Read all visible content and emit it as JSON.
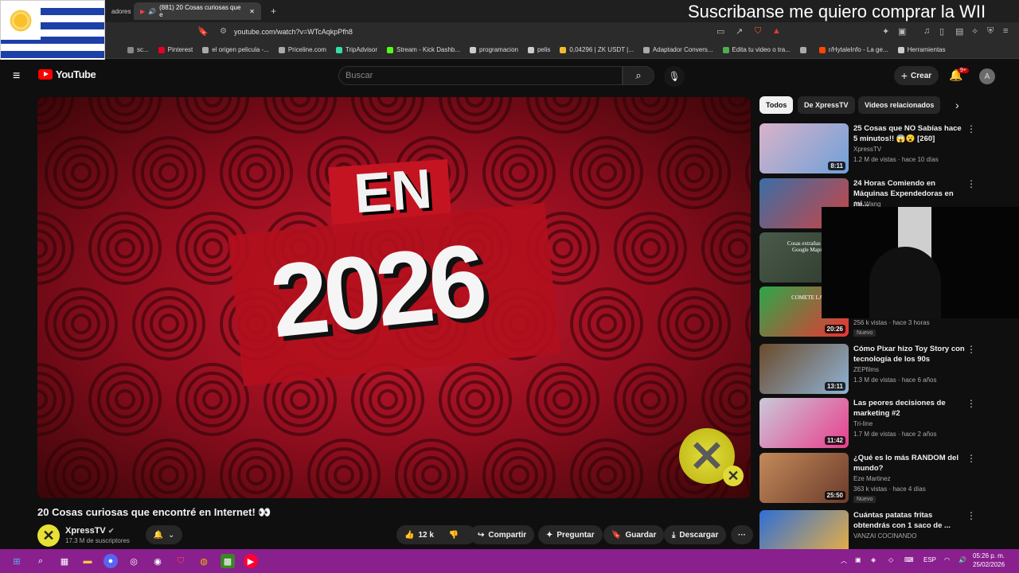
{
  "browser": {
    "tabs": [
      {
        "label": "adores",
        "active": false
      },
      {
        "label": "(881) 20 Cosas curiosas que e",
        "active": true
      }
    ],
    "new_tab": "+",
    "url": "youtube.com/watch?v=WTcAqkpPfh8",
    "bookmarks": [
      {
        "label": "sc...",
        "color": "#888888"
      },
      {
        "label": "Pinterest",
        "color": "#e60023"
      },
      {
        "label": "el origen pelicula -...",
        "color": "#aaaaaa"
      },
      {
        "label": "Priceline.com",
        "color": "#aaaaaa"
      },
      {
        "label": "TripAdvisor",
        "color": "#34e0a1"
      },
      {
        "label": "Stream - Kick Dashb...",
        "color": "#53fc18"
      },
      {
        "label": "programacion",
        "color": "#cccccc"
      },
      {
        "label": "pelis",
        "color": "#cccccc"
      },
      {
        "label": "0,04296 | ZK USDT |...",
        "color": "#f3ba2f"
      },
      {
        "label": "Adaptador Convers...",
        "color": "#aaaaaa"
      },
      {
        "label": "Edita tu video o tra...",
        "color": "#4caf50"
      },
      {
        "label": "",
        "color": "#aaaaaa"
      },
      {
        "label": "r/HytaleInfo - La ge...",
        "color": "#ff4500"
      },
      {
        "label": "Herramientas",
        "color": "#cccccc"
      }
    ]
  },
  "overlay": {
    "scroll_text": "Suscribanse me quiero comprar la WII"
  },
  "youtube": {
    "logo": "YouTube",
    "search_placeholder": "Buscar",
    "create": "Crear",
    "notif_badge": "9+",
    "avatar_letter": "A"
  },
  "video": {
    "en": "EN",
    "year": "2026",
    "title": "20 Cosas curiosas que encontré en Internet! 👀",
    "channel": "XpressTV",
    "subscribers": "17.3 M de suscriptores",
    "likes": "12 k",
    "share": "Compartir",
    "ask": "Preguntar",
    "save": "Guardar",
    "download": "Descargar",
    "more": "···"
  },
  "sidebar": {
    "chips": [
      "Todos",
      "De XpressTV",
      "Videos relacionados"
    ],
    "recs": [
      {
        "title": "25 Cosas que NO Sabías hace 5 minutos!! 😱😮 [260]",
        "channel": "XpressTV",
        "meta": "1.2 M de vistas · hace 10 días",
        "duration": "8:11",
        "new": "",
        "colors": [
          "#d9b3c9",
          "#6fa0d8"
        ]
      },
      {
        "title": "24 Horas Comiendo en Máquinas Expendedoras en mi...",
        "channel": "Ale Wang",
        "meta": "",
        "duration": "",
        "new": "",
        "colors": [
          "#3a6ea5",
          "#c44"
        ]
      },
      {
        "title": "",
        "channel": "",
        "meta": "",
        "duration": "",
        "new": "",
        "colors": [
          "#4a5a4a",
          "#2e3a2e"
        ],
        "thumb_text": "Cosas extrañas en Google Maps"
      },
      {
        "title": "",
        "channel": "",
        "meta": "256 k vistas · hace 3 horas",
        "duration": "20:26",
        "new": "Nuevo",
        "colors": [
          "#2aa84a",
          "#e33"
        ],
        "thumb_text": "COMETE LA"
      },
      {
        "title": "Cómo Pixar hizo Toy Story con tecnología de los 90s",
        "channel": "ZEPfilms",
        "meta": "1.3 M de vistas · hace 6 años",
        "duration": "13:11",
        "new": "",
        "colors": [
          "#6b4a2b",
          "#8fb4d6"
        ]
      },
      {
        "title": "Las peores decisiones de marketing #2",
        "channel": "Tri-line",
        "meta": "1.7 M de vistas · hace 2 años",
        "duration": "11:42",
        "new": "",
        "colors": [
          "#c9c9d9",
          "#e83e8c"
        ]
      },
      {
        "title": "¿Qué es lo más RANDOM del mundo?",
        "channel": "Eze Martinez",
        "meta": "363 k vistas · hace 4 días",
        "duration": "25:50",
        "new": "Nuevo",
        "colors": [
          "#c48a5a",
          "#6b3b2b"
        ]
      },
      {
        "title": "Cuántas patatas fritas obtendrás con 1 saco de ...",
        "channel": "VANZAI COCINANDO",
        "meta": "",
        "duration": "",
        "new": "",
        "colors": [
          "#2f6fd6",
          "#f2b23a"
        ]
      }
    ]
  },
  "taskbar": {
    "lang": "ESP",
    "time": "05:26 p. m.",
    "date": "25/02/2026"
  }
}
